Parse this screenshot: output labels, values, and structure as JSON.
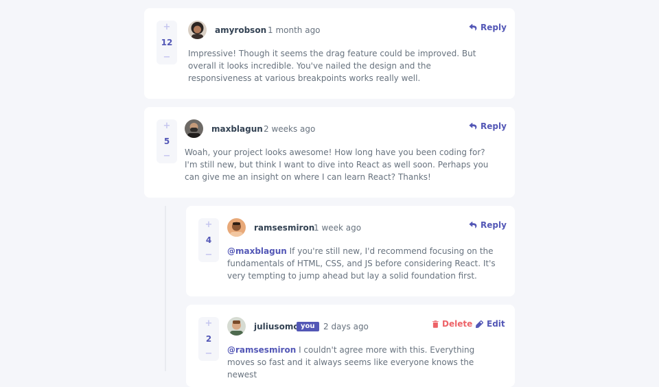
{
  "comments": [
    {
      "username": "amyrobson",
      "time": "1 month ago",
      "score": "12",
      "text": "Impressive! Though it seems the drag feature could be improved. But overall it looks incredible. You've nailed the design and the responsiveness at various breakpoints works really well.",
      "action": "Reply"
    },
    {
      "username": "maxblagun",
      "time": "2 weeks ago",
      "score": "5",
      "text": "Woah, your project looks awesome! How long have you been coding for? I'm still new, but think I want to dive into React as well soon. Perhaps you can give me an insight on where I can learn React? Thanks!",
      "action": "Reply"
    }
  ],
  "replies": [
    {
      "username": "ramsesmiron",
      "time": "1 week ago",
      "score": "4",
      "mention": "@maxblagun",
      "text": " If you're still new, I'd recommend focusing on the fundamentals of HTML, CSS, and JS before considering React. It's very tempting to jump ahead but lay a solid foundation first.",
      "action": "Reply"
    },
    {
      "username": "juliusomo",
      "badge": "you",
      "time": "2 days ago",
      "score": "2",
      "mention": "@ramsesmiron",
      "text": " I couldn't agree more with this. Everything moves so fast and it always seems like everyone knows the newest",
      "delete_label": "Delete",
      "edit_label": "Edit"
    }
  ],
  "controls": {
    "plus": "+",
    "minus": "−"
  },
  "colors": {
    "accent": "#5357b6",
    "danger": "#ed6368",
    "background": "#f5f6fa"
  }
}
